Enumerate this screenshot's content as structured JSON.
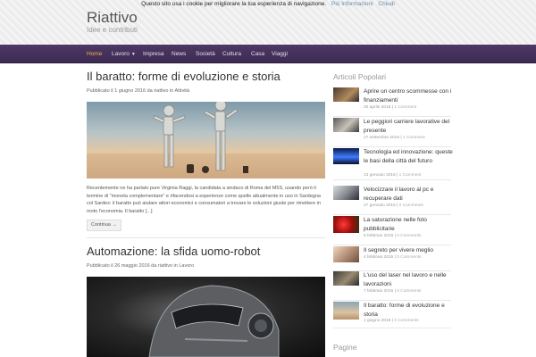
{
  "cookie_bar": {
    "text": "Questo sito usa i cookie per migliorare la tua esperienza di navigazione.",
    "info_link": "Più Informazioni",
    "close_link": "Chiudi"
  },
  "site": {
    "title": "Riattivo",
    "tagline": "Idee e contributi"
  },
  "nav": {
    "items": [
      {
        "label": "Home"
      },
      {
        "label": "Lavoro"
      },
      {
        "label": "Impresa"
      },
      {
        "label": "News"
      },
      {
        "label": "Società"
      },
      {
        "label": "Cultura"
      },
      {
        "label": "Casa"
      },
      {
        "label": "Viaggi"
      }
    ],
    "active_color": "#f1b54a",
    "bar_color": "#4e3865"
  },
  "posts": [
    {
      "title": "Il baratto: forme di evoluzione e storia",
      "meta_prefix": "Pubblicato il ",
      "date": "1 giugno 2016",
      "meta_by": " da ",
      "author": "riattivo",
      "meta_in": " in ",
      "category": "Attività",
      "excerpt": "Recentemente ne ha parlato pure Virginia Raggi, la candidata a sindaco di Roma del M5S, usando però il termine di \"moneta complementare\" e rifacendosi a esperienze come quelle attualmente in uso in Sardegna col Sardex: il baratto può aiutare attori economici e consumatori a trovare le soluzioni giuste per rimettere in moto l'economia. Il baratto [...]",
      "continue_label": "Continua →"
    },
    {
      "title": "Automazione: la sfida uomo-robot",
      "meta_prefix": "Pubblicato il ",
      "date": "26 maggio 2016",
      "meta_by": " da ",
      "author": "riattivo",
      "meta_in": " in ",
      "category": "Lavoro"
    }
  ],
  "sidebar": {
    "popular_title": "Articoli Popolari",
    "pages_title": "Pagine",
    "items": [
      {
        "title": "Aprire un centro scommesse con i finanziamenti",
        "date": "20 aprile 2015",
        "comments": "1 Comment"
      },
      {
        "title": "Le peggiori carriere lavorative del presente",
        "date": "17 settembre 2015",
        "comments": "1 Comment"
      },
      {
        "title": "Tecnologia ed innovazione: queste le basi della città del futuro",
        "date": "13 gennaio 2016",
        "comments": "1 Comment"
      },
      {
        "title": "Velocizzare il lavoro al pc e recuperare dati",
        "date": "27 gennaio 2015",
        "comments": "0 Comments"
      },
      {
        "title": "La saturazione nelle foto pubblicitarie",
        "date": "5 febbraio 2015",
        "comments": "0 Comments"
      },
      {
        "title": "Il segreto per vivere meglio",
        "date": "4 febbraio 2015",
        "comments": "0 Comments"
      },
      {
        "title": "L'uso del laser nel lavoro e nelle lavorazioni",
        "date": "7 febbraio 2015",
        "comments": "0 Comments"
      },
      {
        "title": "Il baratto: forme di evoluzione e storia",
        "date": "1 giugno 2016",
        "comments": "0 Comments"
      }
    ]
  }
}
